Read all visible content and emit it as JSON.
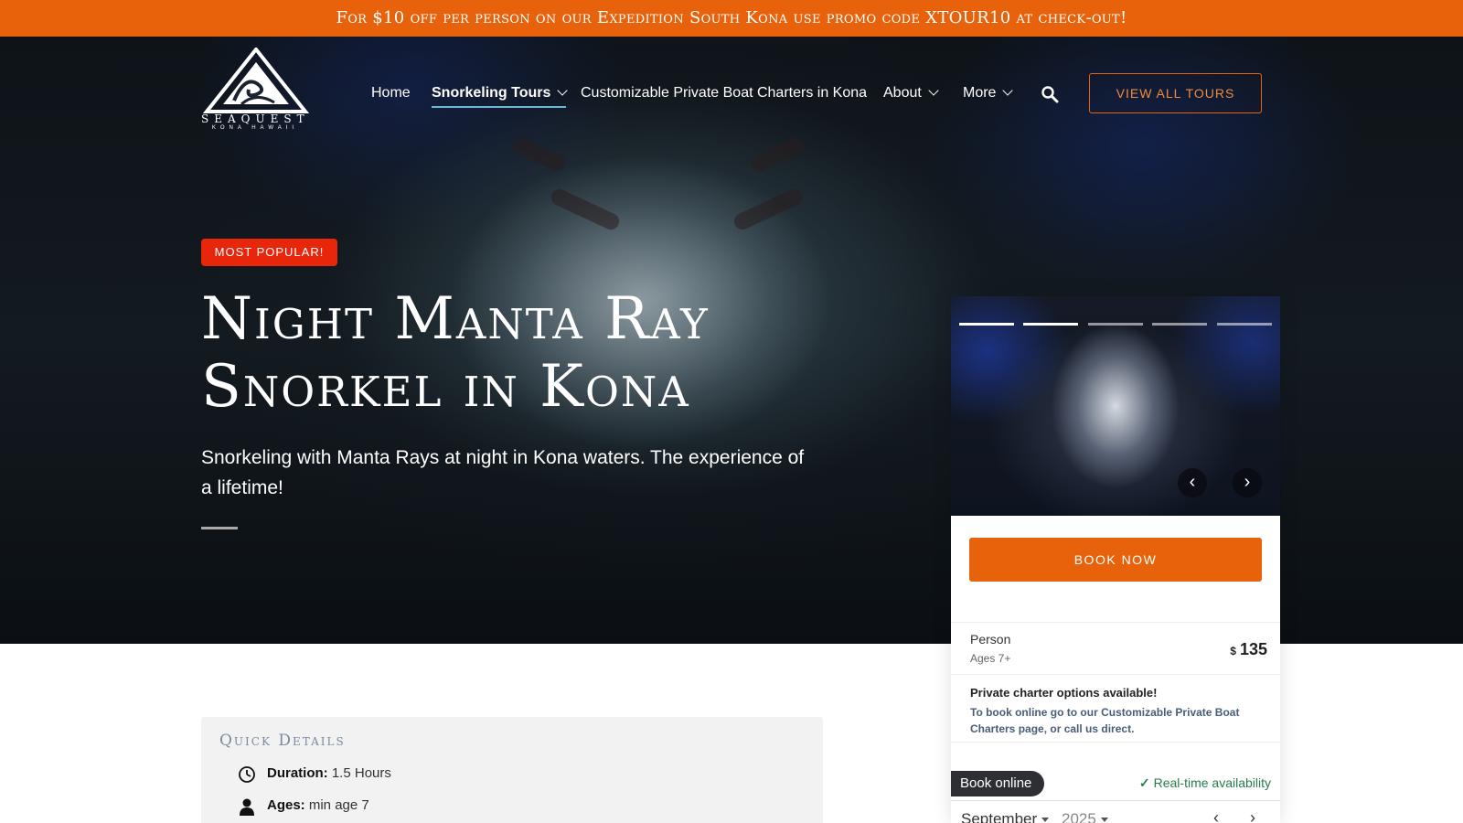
{
  "promo": {
    "text": "For $10 off per person on our Expedition South Kona use promo code XTOUR10 at check-out!"
  },
  "header": {
    "logo": {
      "name": "SEAQUEST",
      "sub": "KONA HAWAII"
    },
    "nav": [
      {
        "label": "Home",
        "dropdown": false,
        "active": false
      },
      {
        "label": "Snorkeling Tours",
        "dropdown": true,
        "active": true
      },
      {
        "label": "Customizable Private Boat Charters in Kona",
        "dropdown": false,
        "active": false
      },
      {
        "label": "About",
        "dropdown": true,
        "active": false
      },
      {
        "label": "More",
        "dropdown": true,
        "active": false
      }
    ],
    "search_icon": "search-icon",
    "view_all_label": "View All Tours"
  },
  "hero": {
    "badge": "MOST POPULAR!",
    "title_line1": "Night Manta Ray",
    "title_line2": "Snorkel in Kona",
    "subtitle": "Snorkeling with Manta Rays at night in Kona waters. The experience of a lifetime!"
  },
  "widget": {
    "slides": {
      "count": 5,
      "current": 2,
      "prev": "‹",
      "next": "›"
    },
    "book_now": "Book Now",
    "price": {
      "label": "Person",
      "sub": "Ages 7+",
      "currency": "$",
      "amount": "135"
    },
    "charter": {
      "title": "Private charter options available!",
      "text": "To book online go to our Customizable Private Boat Charters page, or call us direct."
    },
    "book_online": "Book online",
    "realtime": "Real-time availability",
    "calendar": {
      "month": "September",
      "year": "2025"
    }
  },
  "details": {
    "title": "Quick Details",
    "rows": [
      {
        "icon": "clock-icon",
        "label": "Duration:",
        "value": "1.5 Hours"
      },
      {
        "icon": "person-icon",
        "label": "Ages:",
        "value": "min age 7"
      }
    ]
  },
  "colors": {
    "accent": "#e8620c",
    "badge": "#e8260c",
    "active_underline": "#6fb6d6"
  }
}
